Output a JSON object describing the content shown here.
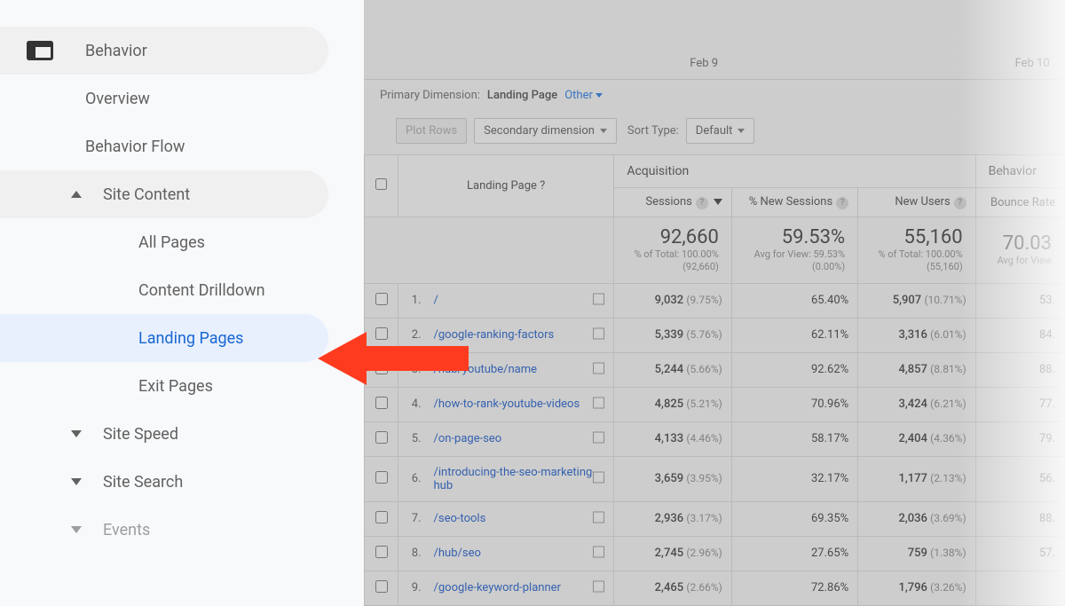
{
  "sidebar": {
    "root": {
      "label": "Behavior"
    },
    "items": [
      {
        "label": "Overview",
        "level": 1
      },
      {
        "label": "Behavior Flow",
        "level": 1
      },
      {
        "label": "Site Content",
        "level": 1,
        "expanded": true
      },
      {
        "label": "All Pages",
        "level": 2
      },
      {
        "label": "Content Drilldown",
        "level": 2
      },
      {
        "label": "Landing Pages",
        "level": 2,
        "active": true
      },
      {
        "label": "Exit Pages",
        "level": 2
      },
      {
        "label": "Site Speed",
        "level": 1,
        "collapsed": true
      },
      {
        "label": "Site Search",
        "level": 1,
        "collapsed": true
      },
      {
        "label": "Events",
        "level": 1,
        "collapsed": true
      }
    ]
  },
  "chart": {
    "dates": [
      "Feb 9",
      "Feb 10"
    ]
  },
  "controls": {
    "primary_dimension_label": "Primary Dimension:",
    "primary_dimension": "Landing Page",
    "other": "Other",
    "plot_rows": "Plot Rows",
    "secondary_dimension": "Secondary dimension",
    "sort_type_label": "Sort Type:",
    "sort_type": "Default"
  },
  "table": {
    "header": {
      "landing_page": "Landing Page",
      "acquisition": "Acquisition",
      "behavior": "Behavior",
      "sessions": "Sessions",
      "new_sessions": "% New Sessions",
      "new_users": "New Users",
      "bounce_rate": "Bounce Rate"
    },
    "summary": {
      "sessions": {
        "value": "92,660",
        "sub1": "% of Total: 100.00%",
        "sub2": "(92,660)"
      },
      "new_sessions": {
        "value": "59.53%",
        "sub1": "Avg for View: 59.53%",
        "sub2": "(0.00%)"
      },
      "new_users": {
        "value": "55,160",
        "sub1": "% of Total: 100.00%",
        "sub2": "(55,160)"
      },
      "bounce_rate": {
        "value": "70.03",
        "sub1": "Avg for View"
      }
    },
    "rows": [
      {
        "idx": "1.",
        "path": "/",
        "sessions": "9,032",
        "sessions_pct": "(9.75%)",
        "new_sessions": "65.40%",
        "new_users": "5,907",
        "new_users_pct": "(10.71%)",
        "bounce": "53."
      },
      {
        "idx": "2.",
        "path": "/google-ranking-factors",
        "sessions": "5,339",
        "sessions_pct": "(5.76%)",
        "new_sessions": "62.11%",
        "new_users": "3,316",
        "new_users_pct": "(6.01%)",
        "bounce": "84."
      },
      {
        "idx": "3.",
        "path": "/hub/youtube/name",
        "sessions": "5,244",
        "sessions_pct": "(5.66%)",
        "new_sessions": "92.62%",
        "new_users": "4,857",
        "new_users_pct": "(8.81%)",
        "bounce": "88."
      },
      {
        "idx": "4.",
        "path": "/how-to-rank-youtube-videos",
        "sessions": "4,825",
        "sessions_pct": "(5.21%)",
        "new_sessions": "70.96%",
        "new_users": "3,424",
        "new_users_pct": "(6.21%)",
        "bounce": "77."
      },
      {
        "idx": "5.",
        "path": "/on-page-seo",
        "sessions": "4,133",
        "sessions_pct": "(4.46%)",
        "new_sessions": "58.17%",
        "new_users": "2,404",
        "new_users_pct": "(4.36%)",
        "bounce": "79."
      },
      {
        "idx": "6.",
        "path": "/introducing-the-seo-marketing-hub",
        "sessions": "3,659",
        "sessions_pct": "(3.95%)",
        "new_sessions": "32.17%",
        "new_users": "1,177",
        "new_users_pct": "(2.13%)",
        "bounce": "56."
      },
      {
        "idx": "7.",
        "path": "/seo-tools",
        "sessions": "2,936",
        "sessions_pct": "(3.17%)",
        "new_sessions": "69.35%",
        "new_users": "2,036",
        "new_users_pct": "(3.69%)",
        "bounce": "88."
      },
      {
        "idx": "8.",
        "path": "/hub/seo",
        "sessions": "2,745",
        "sessions_pct": "(2.96%)",
        "new_sessions": "27.65%",
        "new_users": "759",
        "new_users_pct": "(1.38%)",
        "bounce": "57."
      },
      {
        "idx": "9.",
        "path": "/google-keyword-planner",
        "sessions": "2,465",
        "sessions_pct": "(2.66%)",
        "new_sessions": "72.86%",
        "new_users": "1,796",
        "new_users_pct": "(3.26%)",
        "bounce": ""
      }
    ]
  }
}
